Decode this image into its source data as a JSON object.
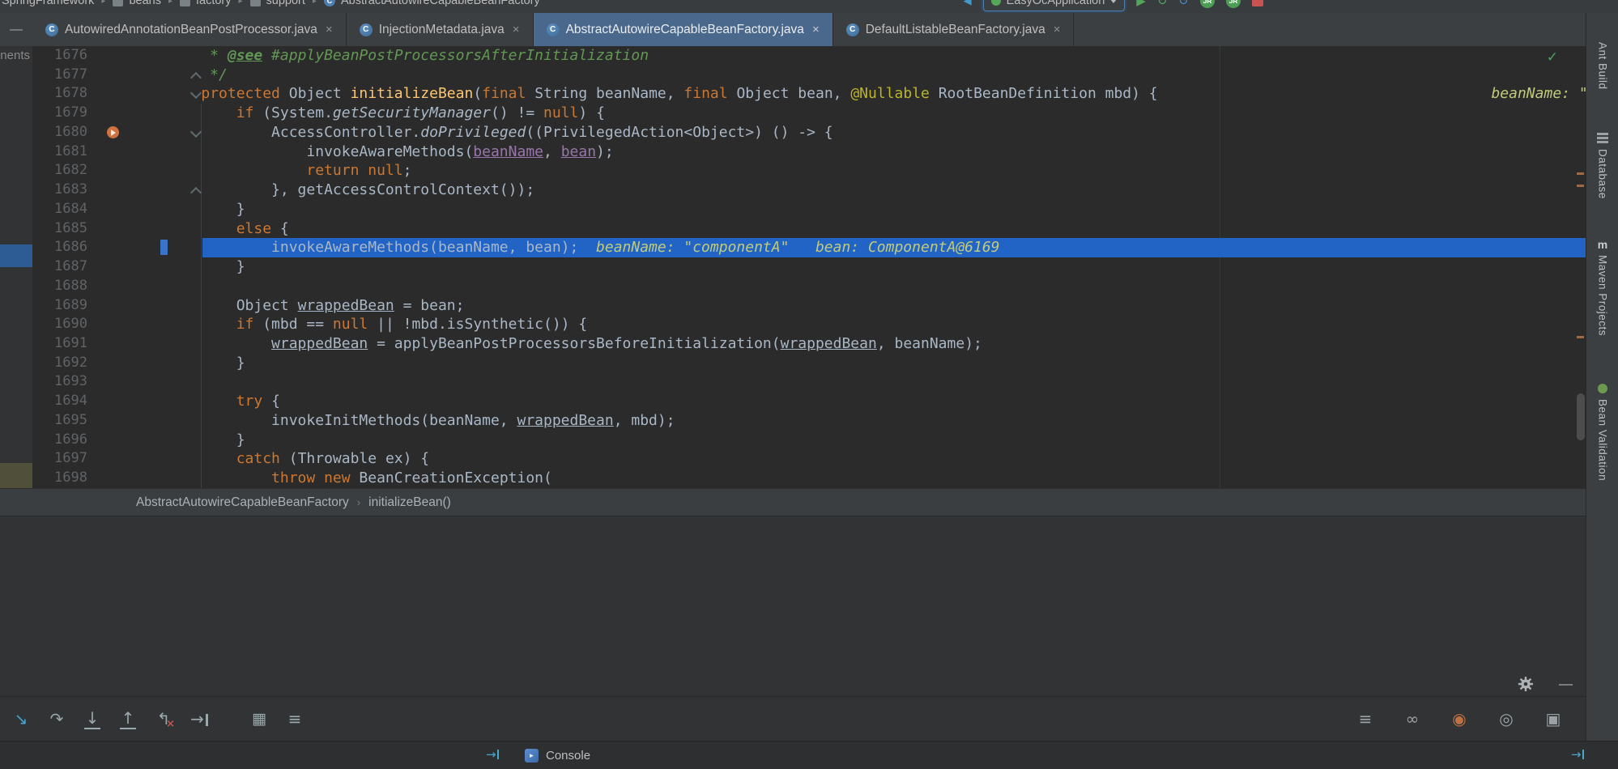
{
  "navbar": {
    "path": [
      "SpringFramework",
      "beans",
      "factory",
      "support",
      "AbstractAutowireCapableBeanFactory"
    ],
    "run_config": "EasyOcApplication"
  },
  "tabs": [
    {
      "label": "AutowiredAnnotationBeanPostProcessor.java",
      "active": false
    },
    {
      "label": "InjectionMetadata.java",
      "active": false
    },
    {
      "label": "AbstractAutowireCapableBeanFactory.java",
      "active": true
    },
    {
      "label": "DefaultListableBeanFactory.java",
      "active": false
    }
  ],
  "editor": {
    "lines": [
      {
        "n": 1676,
        "seg": [
          [
            "c",
            "     * "
          ],
          [
            "ct",
            "@see"
          ],
          [
            "c",
            " #applyBeanPostProcessorsAfterInitialization"
          ]
        ]
      },
      {
        "n": 1677,
        "fold": "up",
        "seg": [
          [
            "c",
            "     */"
          ]
        ]
      },
      {
        "n": 1678,
        "fold": "down",
        "seg": [
          [
            "d",
            "    "
          ],
          [
            "k",
            "protected "
          ],
          [
            "d",
            "Object "
          ],
          [
            "m",
            "initializeBean"
          ],
          [
            "d",
            "("
          ],
          [
            "k",
            "final "
          ],
          [
            "d",
            "String beanName, "
          ],
          [
            "k",
            "final "
          ],
          [
            "d",
            "Object bean, "
          ],
          [
            "a",
            "@Nullable "
          ],
          [
            "d",
            "RootBeanDefinition mbd) {"
          ],
          [
            "g",
            "                                      beanName: \"componentA\""
          ]
        ]
      },
      {
        "n": 1679,
        "seg": [
          [
            "d",
            "        "
          ],
          [
            "k",
            "if "
          ],
          [
            "d",
            "(System."
          ],
          [
            "i",
            "getSecurityManager"
          ],
          [
            "d",
            "() != "
          ],
          [
            "k",
            "null"
          ],
          [
            "d",
            ") {"
          ]
        ]
      },
      {
        "n": 1680,
        "fold": "down",
        "bp": true,
        "seg": [
          [
            "d",
            "            AccessController."
          ],
          [
            "i",
            "doPrivileged"
          ],
          [
            "d",
            "((PrivilegedAction<Object>) () -> {"
          ]
        ]
      },
      {
        "n": 1681,
        "seg": [
          [
            "d",
            "                invokeAwareMethods("
          ],
          [
            "p",
            "beanName"
          ],
          [
            "d",
            ", "
          ],
          [
            "p",
            "bean"
          ],
          [
            "d",
            ");"
          ]
        ]
      },
      {
        "n": 1682,
        "seg": [
          [
            "d",
            "                "
          ],
          [
            "k",
            "return null"
          ],
          [
            "d",
            ";"
          ]
        ]
      },
      {
        "n": 1683,
        "fold": "up",
        "seg": [
          [
            "d",
            "            }, getAccessControlContext());"
          ]
        ]
      },
      {
        "n": 1684,
        "seg": [
          [
            "d",
            "        }"
          ]
        ]
      },
      {
        "n": 1685,
        "seg": [
          [
            "d",
            "        "
          ],
          [
            "k",
            "else "
          ],
          [
            "d",
            "{"
          ]
        ]
      },
      {
        "n": 1686,
        "hl": true,
        "seg": [
          [
            "d",
            "            invokeAwareMethods(beanName, bean);"
          ],
          [
            "g",
            "  beanName: \"componentA\"   bean: ComponentA@6169"
          ]
        ]
      },
      {
        "n": 1687,
        "seg": [
          [
            "d",
            "        }"
          ]
        ]
      },
      {
        "n": 1688,
        "seg": []
      },
      {
        "n": 1689,
        "seg": [
          [
            "d",
            "        Object "
          ],
          [
            "u",
            "wrappedBean"
          ],
          [
            "d",
            " = bean;"
          ]
        ]
      },
      {
        "n": 1690,
        "seg": [
          [
            "d",
            "        "
          ],
          [
            "k",
            "if "
          ],
          [
            "d",
            "(mbd == "
          ],
          [
            "k",
            "null "
          ],
          [
            "d",
            "|| !mbd.isSynthetic()) {"
          ]
        ]
      },
      {
        "n": 1691,
        "seg": [
          [
            "d",
            "            "
          ],
          [
            "u",
            "wrappedBean"
          ],
          [
            "d",
            " = applyBeanPostProcessorsBeforeInitialization("
          ],
          [
            "u",
            "wrappedBean"
          ],
          [
            "d",
            ", beanName);"
          ]
        ]
      },
      {
        "n": 1692,
        "seg": [
          [
            "d",
            "        }"
          ]
        ]
      },
      {
        "n": 1693,
        "seg": []
      },
      {
        "n": 1694,
        "seg": [
          [
            "d",
            "        "
          ],
          [
            "k",
            "try "
          ],
          [
            "d",
            "{"
          ]
        ]
      },
      {
        "n": 1695,
        "seg": [
          [
            "d",
            "            invokeInitMethods(beanName, "
          ],
          [
            "u",
            "wrappedBean"
          ],
          [
            "d",
            ", mbd);"
          ]
        ]
      },
      {
        "n": 1696,
        "seg": [
          [
            "d",
            "        }"
          ]
        ]
      },
      {
        "n": 1697,
        "seg": [
          [
            "d",
            "        "
          ],
          [
            "k",
            "catch "
          ],
          [
            "d",
            "(Throwable ex) {"
          ]
        ]
      },
      {
        "n": 1698,
        "seg": [
          [
            "d",
            "            "
          ],
          [
            "k",
            "throw new "
          ],
          [
            "d",
            "BeanCreationException("
          ]
        ]
      }
    ]
  },
  "breadcrumb": {
    "items": [
      "AbstractAutowireCapableBeanFactory",
      "initializeBean()"
    ]
  },
  "left_panel": {
    "clipped_text": "nents"
  },
  "right_stripe": {
    "items": [
      "Ant Build",
      "Database",
      "Maven Projects",
      "Bean Validation"
    ]
  },
  "console_bar": {
    "label": "Console"
  },
  "icons": {
    "class_letter": "C",
    "close": "×",
    "path_sep": "▸",
    "crumb_sep": "›",
    "back": "◀",
    "play": "▶",
    "rerun": "↻",
    "update": "↺",
    "jr": "JR",
    "minus": "—",
    "check": "✓",
    "show_exec": "↘",
    "step_over": "↷",
    "step_into": "↓",
    "step_out": "↑",
    "drop_frame": "↰",
    "drop_frame_x": "×",
    "run_to_cursor": "→",
    "grid": "▦",
    "lines": "≡",
    "infinity": "∞",
    "record": "◉",
    "target": "◎",
    "window": "▣",
    "arrow": "→",
    "maven": "m"
  },
  "colors": {
    "editor_bg": "#2B2B2B",
    "panel_bg": "#313335",
    "tabbar_bg": "#3C3F41",
    "active_tab_bg": "#4A688C",
    "execution_line": "#2264C5",
    "keyword": "#CC7832",
    "comment": "#629755",
    "method_decl": "#FFC66D",
    "annotation": "#BBB529",
    "debug_hint": "#C0CA7A",
    "line_number": "#606366"
  }
}
